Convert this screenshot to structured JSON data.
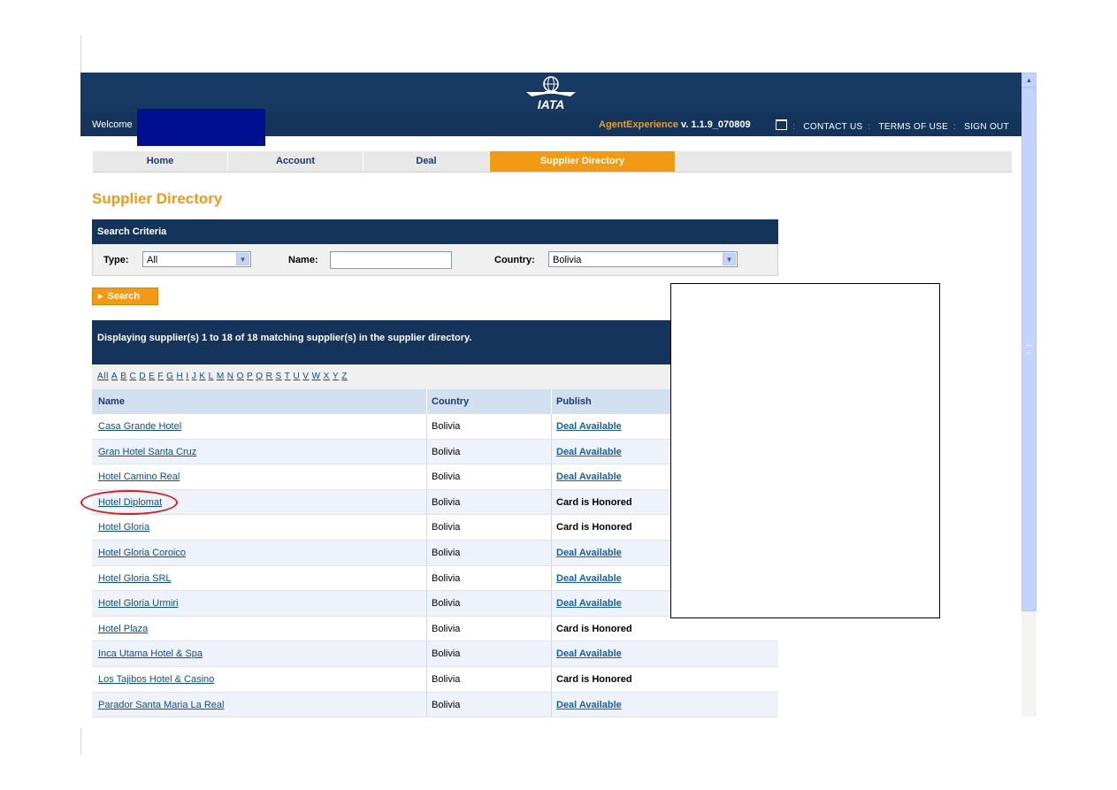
{
  "header": {
    "logo_text": "IATA",
    "welcome": "Welcome",
    "product": "AgentExperience",
    "version": "v. 1.1.9_070809",
    "links": [
      "CONTACT US",
      "TERMS OF USE",
      "SIGN OUT"
    ]
  },
  "nav": {
    "items": [
      "Home",
      "Account",
      "Deal",
      "Supplier Directory"
    ],
    "active": "Supplier Directory"
  },
  "page_title": "Supplier Directory",
  "search": {
    "heading": "Search Criteria",
    "type_label": "Type:",
    "type_value": "All",
    "name_label": "Name:",
    "name_value": "",
    "country_label": "Country:",
    "country_value": "Bolivia",
    "button": "Search"
  },
  "results": {
    "summary": "Displaying supplier(s) 1 to 18 of 18 matching supplier(s) in the supplier directory.",
    "alphabet": [
      "All",
      "A",
      "B",
      "C",
      "D",
      "E",
      "F",
      "G",
      "H",
      "I",
      "J",
      "K",
      "L",
      "M",
      "N",
      "O",
      "P",
      "Q",
      "R",
      "S",
      "T",
      "U",
      "V",
      "W",
      "X",
      "Y",
      "Z"
    ],
    "columns": [
      "Name",
      "Country",
      "Publish"
    ],
    "rows": [
      {
        "name": "Casa Grande Hotel",
        "country": "Bolivia",
        "publish": "Deal Available"
      },
      {
        "name": "Gran Hotel Santa Cruz",
        "country": "Bolivia",
        "publish": "Deal Available"
      },
      {
        "name": "Hotel Camino Real",
        "country": "Bolivia",
        "publish": "Deal Available"
      },
      {
        "name": "Hotel Diplomat",
        "country": "Bolivia",
        "publish": "Card is Honored"
      },
      {
        "name": "Hotel Gloria",
        "country": "Bolivia",
        "publish": "Card is Honored"
      },
      {
        "name": "Hotel Gloria Coroico",
        "country": "Bolivia",
        "publish": "Deal Available"
      },
      {
        "name": "Hotel Gloria SRL",
        "country": "Bolivia",
        "publish": "Deal Available"
      },
      {
        "name": "Hotel Gloria Urmiri",
        "country": "Bolivia",
        "publish": "Deal Available"
      },
      {
        "name": "Hotel Plaza",
        "country": "Bolivia",
        "publish": "Card is Honored"
      },
      {
        "name": "Inca Utama Hotel & Spa",
        "country": "Bolivia",
        "publish": "Deal Available"
      },
      {
        "name": "Los Tajibos Hotel & Casino",
        "country": "Bolivia",
        "publish": "Card is Honored"
      },
      {
        "name": "Parador Santa Maria La Real",
        "country": "Bolivia",
        "publish": "Deal Available"
      }
    ]
  },
  "colors": {
    "header_bg": "#173963",
    "accent": "#f39a12",
    "link": "#0b4f8c",
    "highlight": "#e0191b"
  }
}
